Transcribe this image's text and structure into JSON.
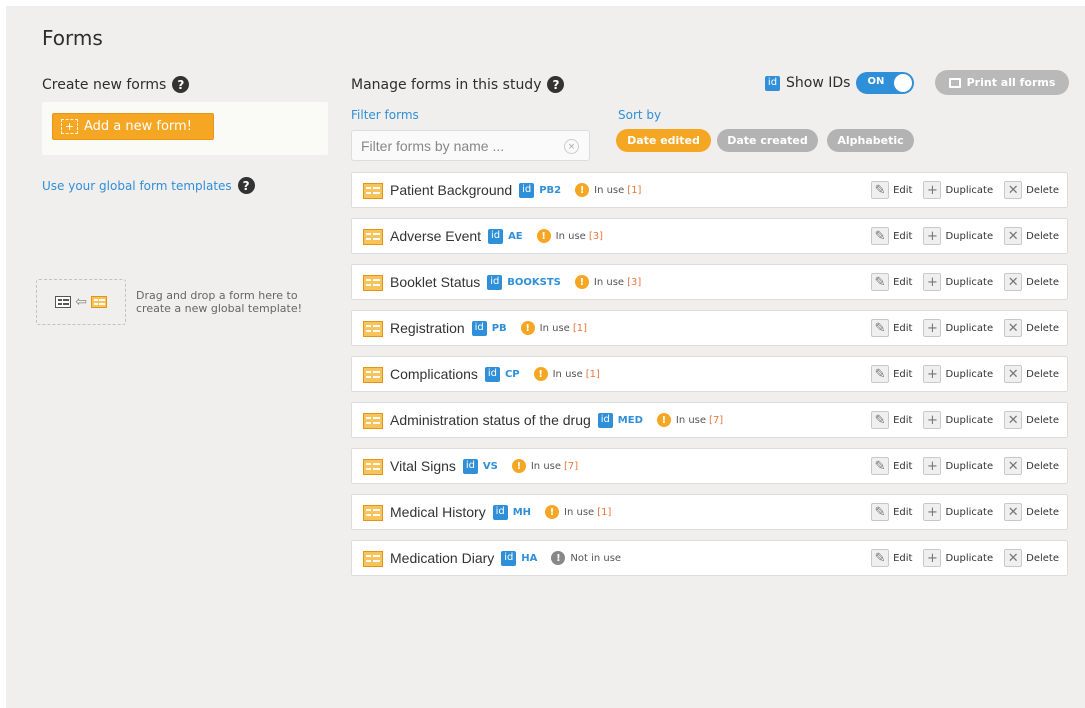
{
  "page": {
    "title": "Forms"
  },
  "create": {
    "heading": "Create new forms",
    "help_glyph": "?",
    "add_button_label": "Add a new form!",
    "plus_glyph": "+",
    "templates_link": "Use your global form templates",
    "drop_text": "Drag and drop a form here to create a new global template!"
  },
  "manage": {
    "heading": "Manage forms in this study",
    "help_glyph": "?",
    "show_ids_label": "Show IDs",
    "id_glyph": "id",
    "toggle_label": "ON",
    "print_label": "Print all forms",
    "filter_label": "Filter forms",
    "filter_placeholder": "Filter forms by name ...",
    "clear_glyph": "×",
    "sort_label": "Sort by",
    "sort_options": [
      "Date edited",
      "Date created",
      "Alphabetic"
    ],
    "active_sort": "Date edited"
  },
  "action_labels": {
    "edit": "Edit",
    "duplicate": "Duplicate",
    "delete": "Delete"
  },
  "action_glyphs": {
    "edit": "✎",
    "duplicate": "+",
    "delete": "✕"
  },
  "usage_glyph": "!",
  "forms": [
    {
      "name": "Patient Background",
      "id": "PB2",
      "status": "In use",
      "count": "[1]"
    },
    {
      "name": "Adverse Event",
      "id": "AE",
      "status": "In use",
      "count": "[3]"
    },
    {
      "name": "Booklet Status",
      "id": "BOOKSTS",
      "status": "In use",
      "count": "[3]"
    },
    {
      "name": "Registration",
      "id": "PB",
      "status": "In use",
      "count": "[1]"
    },
    {
      "name": "Complications",
      "id": "CP",
      "status": "In use",
      "count": "[1]"
    },
    {
      "name": "Administration status of the drug",
      "id": "MED",
      "status": "In use",
      "count": "[7]"
    },
    {
      "name": "Vital Signs",
      "id": "VS",
      "status": "In use",
      "count": "[7]"
    },
    {
      "name": "Medical History",
      "id": "MH",
      "status": "In use",
      "count": "[1]"
    },
    {
      "name": "Medication Diary",
      "id": "HA",
      "status": "Not in use",
      "count": ""
    }
  ],
  "colors": {
    "accent": "#f5a623",
    "link": "#2f8fd8",
    "background": "#f1efed",
    "count": "#e8773f"
  }
}
